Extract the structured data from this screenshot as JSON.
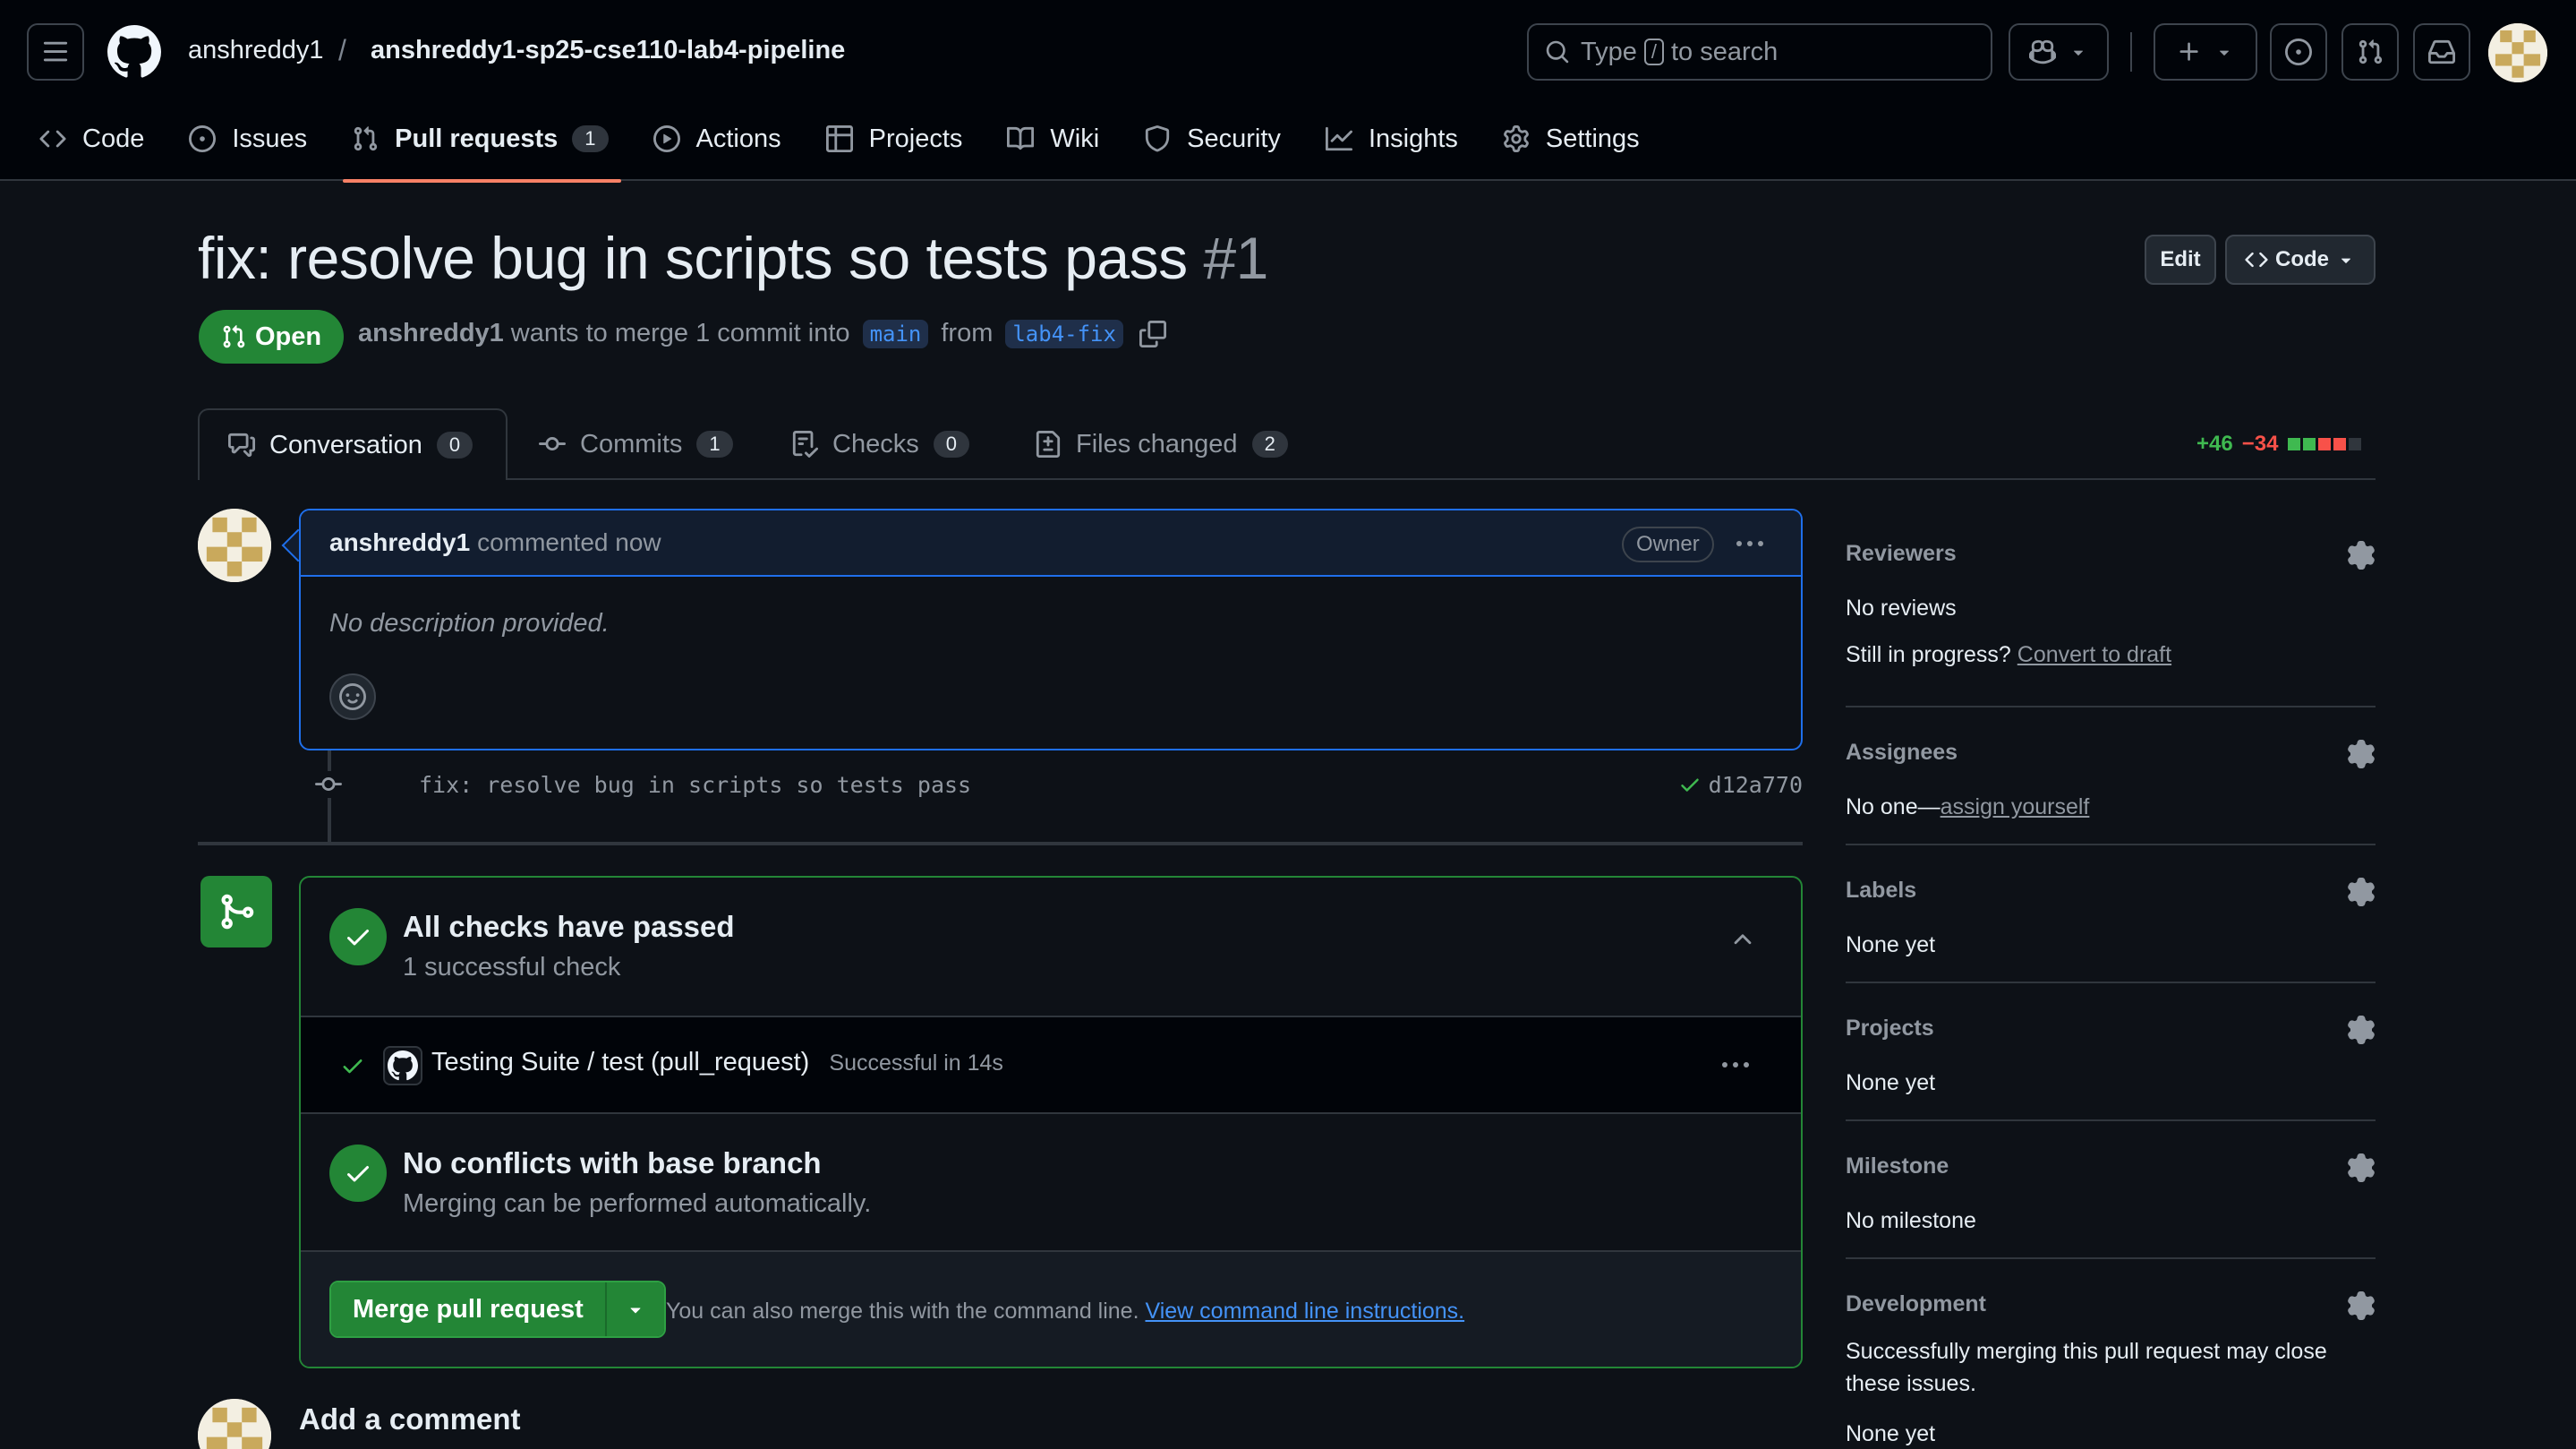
{
  "header": {
    "owner": "anshreddy1",
    "separator": "/",
    "repo": "anshreddy1-sp25-cse110-lab4-pipeline",
    "search_prefix": "Type",
    "search_key": "/",
    "search_suffix": "to search"
  },
  "repo_nav": [
    {
      "label": "Code",
      "icon": "code-icon"
    },
    {
      "label": "Issues",
      "icon": "issue-opened-icon"
    },
    {
      "label": "Pull requests",
      "icon": "git-pull-request-icon",
      "count": "1",
      "active": true
    },
    {
      "label": "Actions",
      "icon": "play-icon"
    },
    {
      "label": "Projects",
      "icon": "table-icon"
    },
    {
      "label": "Wiki",
      "icon": "book-icon"
    },
    {
      "label": "Security",
      "icon": "shield-icon"
    },
    {
      "label": "Insights",
      "icon": "graph-icon"
    },
    {
      "label": "Settings",
      "icon": "gear-icon"
    }
  ],
  "pr": {
    "title": "fix: resolve bug in scripts so tests pass",
    "number": "#1",
    "state": "Open",
    "author": "anshreddy1",
    "meta_text": "wants to merge 1 commit into",
    "base_branch": "main",
    "from_text": "from",
    "head_branch": "lab4-fix",
    "edit_label": "Edit",
    "code_label": "Code"
  },
  "tabs": [
    {
      "label": "Conversation",
      "count": "0",
      "icon": "comment-discussion-icon"
    },
    {
      "label": "Commits",
      "count": "1",
      "icon": "git-commit-icon"
    },
    {
      "label": "Checks",
      "count": "0",
      "icon": "checklist-icon"
    },
    {
      "label": "Files changed",
      "count": "2",
      "icon": "file-diff-icon"
    }
  ],
  "diffstat": {
    "additions": "+46",
    "deletions": "−34"
  },
  "comment": {
    "author": "anshreddy1",
    "action": "commented now",
    "badge": "Owner",
    "body": "No description provided."
  },
  "commit": {
    "message": "fix: resolve bug in scripts so tests pass",
    "sha": "d12a770"
  },
  "merge_box": {
    "checks_title": "All checks have passed",
    "checks_sub": "1 successful check",
    "check_name": "Testing Suite / test (pull_request)",
    "check_status": "Successful in 14s",
    "conflicts_title": "No conflicts with base branch",
    "conflicts_sub": "Merging can be performed automatically.",
    "merge_label": "Merge pull request",
    "hint_text": "You can also merge this with the command line.",
    "hint_link": "View command line instructions."
  },
  "add_comment": "Add a comment",
  "sidebar": {
    "reviewers": {
      "title": "Reviewers",
      "text": "No reviews",
      "progress_text": "Still in progress?",
      "progress_link": "Convert to draft"
    },
    "assignees": {
      "title": "Assignees",
      "text": "No one—",
      "link": "assign yourself"
    },
    "labels": {
      "title": "Labels",
      "text": "None yet"
    },
    "projects": {
      "title": "Projects",
      "text": "None yet"
    },
    "milestone": {
      "title": "Milestone",
      "text": "No milestone"
    },
    "development": {
      "title": "Development",
      "text": "Successfully merging this pull request may close these issues.",
      "text2": "None yet"
    }
  },
  "colors": {
    "accent_green": "#238636",
    "accent_blue": "#1f6feb",
    "link_blue": "#4493f8",
    "tab_underline": "#f78166",
    "bg": "#0d1117"
  }
}
